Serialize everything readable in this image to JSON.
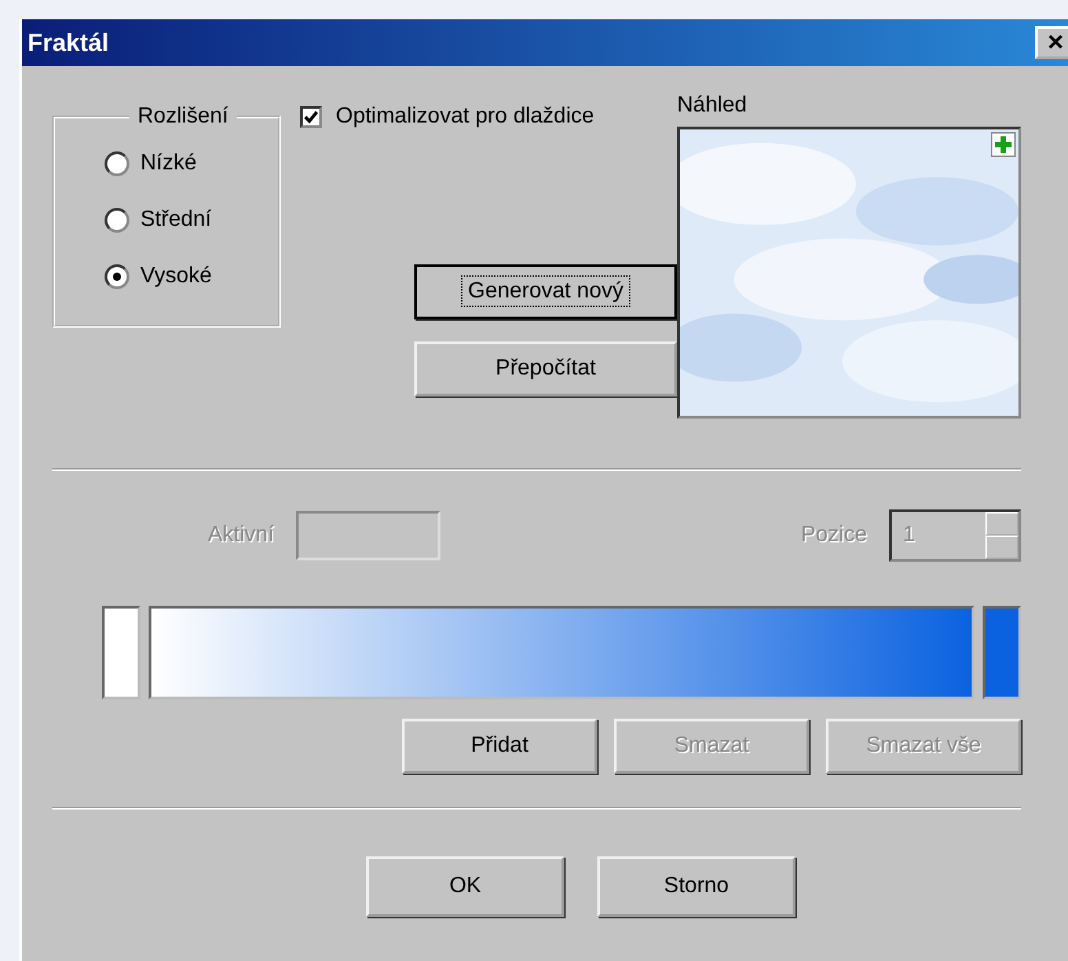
{
  "window": {
    "title": "Fraktál",
    "close": "×"
  },
  "resolution": {
    "label": "Rozlišení",
    "options": [
      {
        "label": "Nízké",
        "selected": false
      },
      {
        "label": "Střední",
        "selected": false
      },
      {
        "label": "Vysoké",
        "selected": true
      }
    ]
  },
  "optimize": {
    "label": "Optimalizovat pro dlaždice",
    "checked": true
  },
  "preview": {
    "label": "Náhled"
  },
  "actions": [
    {
      "label": "Generovat nový",
      "focused": true
    },
    {
      "label": "Přepočítat",
      "focused": false
    }
  ],
  "active": {
    "label": "Aktivní",
    "disabled": true
  },
  "position": {
    "label": "Pozice",
    "value": "1",
    "disabled": true
  },
  "gradient": {
    "stops": [
      {
        "color": "#ffffff"
      },
      {
        "color": "#0b62e0"
      }
    ]
  },
  "stop_buttons": [
    {
      "label": "Přidat",
      "disabled": false
    },
    {
      "label": "Smazat",
      "disabled": true
    },
    {
      "label": "Smazat vše",
      "disabled": true
    }
  ],
  "dialog_buttons": [
    {
      "label": "OK"
    },
    {
      "label": "Storno"
    }
  ]
}
